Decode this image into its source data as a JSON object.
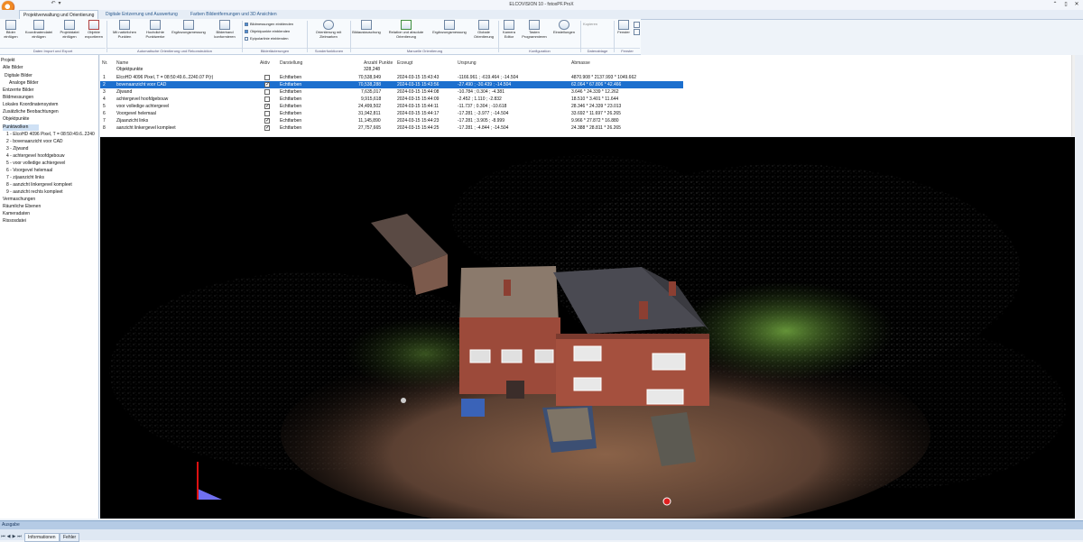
{
  "window": {
    "title": "ELCOVISION 10 - fotoxPF.ProX",
    "controls": [
      "⌃",
      "▯",
      "✕"
    ]
  },
  "quick_access": [
    "↶",
    "▾"
  ],
  "tabs": [
    {
      "label": "Projektverwaltung und Orientierung",
      "active": true
    },
    {
      "label": "Digitale Entzerrung und Auswertung",
      "active": false
    },
    {
      "label": "Farben Bildentfernungen und 3D Ansichten",
      "active": false
    }
  ],
  "ribbon": {
    "buttons": [
      {
        "label": "Bilder einfügen"
      },
      {
        "label": "Koordinatendatei einfügen"
      },
      {
        "label": "Projektdatei einfügen"
      },
      {
        "label": "Objekte exportieren"
      },
      {
        "label": "Mit natürlichen Punkten"
      },
      {
        "label": "Hochdichte Punktwerke"
      },
      {
        "label": "Ergänzungsmessung"
      },
      {
        "label": "Bilderband konformieren"
      },
      {
        "label": "Orientierung mit Zielmarken"
      },
      {
        "label": "Bildaustauschung"
      },
      {
        "label": "Relative und absolute Orientierung"
      },
      {
        "label": "Ergänzungsmessung"
      },
      {
        "label": "Globale Orientierung"
      },
      {
        "label": "Kamera Editor"
      },
      {
        "label": "Tasten Programmieren"
      },
      {
        "label": "Einstellungen"
      },
      {
        "label": "Fenster"
      }
    ],
    "checkboxes": [
      {
        "label": "Bildmessungen einblenden",
        "checked": true
      },
      {
        "label": "Objektpunkte einblenden",
        "checked": true
      },
      {
        "label": "Epipolarlinie einblenden",
        "checked": false
      }
    ],
    "groups": [
      "Daten Import und Export",
      "Automatische Orientierung und Rekonstruktion",
      "Bilderläuterungen",
      "Sonderfunktionen",
      "Manuelle Orientierung",
      "Konfiguration",
      "Datenablage",
      "Fenster"
    ],
    "misc_label": "Kopieren"
  },
  "tree": [
    {
      "label": "Projekt",
      "indent": 0
    },
    {
      "label": "Alle Bilder",
      "indent": 1
    },
    {
      "label": "Digitale Bilder",
      "indent": 2
    },
    {
      "label": "Analoge Bilder",
      "indent": 3
    },
    {
      "label": "Entzerrte Bilder",
      "indent": 1
    },
    {
      "label": "Bildmessungen",
      "indent": 1
    },
    {
      "label": "Lokales Koordinatensystem",
      "indent": 1
    },
    {
      "label": "Zusätzliche Beobachtungen",
      "indent": 1
    },
    {
      "label": "Objektpunkte",
      "indent": 1
    },
    {
      "label": "Punktwolken",
      "indent": 1,
      "selected": true
    },
    {
      "label": "1 - ElcoHD 4096 Pixel, T = 08:50:49.6..2240",
      "indent": 2
    },
    {
      "label": "2 - bovenaanzicht voor CAD",
      "indent": 2
    },
    {
      "label": "3 - Zijwand",
      "indent": 2
    },
    {
      "label": "4 - achtergevel hoofdgebouw",
      "indent": 2
    },
    {
      "label": "5 - voor volledige achtergevel",
      "indent": 2
    },
    {
      "label": "6 - Voorgevel helemaal",
      "indent": 2
    },
    {
      "label": "7 - zijaanzicht links",
      "indent": 2
    },
    {
      "label": "8 - aanzicht linkergevel kompleet",
      "indent": 2
    },
    {
      "label": "9 - aanzicht rechts kompleet",
      "indent": 2
    },
    {
      "label": "Vermaschungen",
      "indent": 1
    },
    {
      "label": "Räumliche Ebenen",
      "indent": 1
    },
    {
      "label": "Kameradaten",
      "indent": 1
    },
    {
      "label": "Rissosdatei",
      "indent": 1
    }
  ],
  "table": {
    "headers": [
      "Nr.",
      "Name",
      "Aktiv",
      "Darstellung",
      "Anzahl Punkte",
      "Erzeugt",
      "Ursprung",
      "Abmasse"
    ],
    "rows": [
      {
        "nr": "",
        "name": "Objektpunkte",
        "active": false,
        "display": "",
        "count": "328,248",
        "created": "",
        "origin": "",
        "dims": ""
      },
      {
        "nr": "1",
        "name": "ElcoHD 4096 Pixel, T = 08:50:49.6..2240.07 P(r)",
        "active": false,
        "display": "Echtfarben",
        "count": "70,538,949",
        "created": "2024-03-15  15:43:43",
        "origin": "-1166.961 ; -619.464 ; -14.504",
        "dims": "4870.908 * 2137.993 * 1049.662"
      },
      {
        "nr": "2",
        "name": "bovenaanzicht voor CAD",
        "active": true,
        "display": "Echtfarben",
        "count": "70,538,288",
        "created": "2024-03-15  15:43:56",
        "origin": "-27.490 ; -30.439 ; -14.504",
        "dims": "62.064 * 67.806 * 42.466",
        "selected": true
      },
      {
        "nr": "3",
        "name": "Zijwand",
        "active": false,
        "display": "Echtfarben",
        "count": "7,635,017",
        "created": "2024-03-15  15:44:08",
        "origin": "-10.784 ; 0.304 ; -4.381",
        "dims": "3.646 * 24.339 * 12.262"
      },
      {
        "nr": "4",
        "name": "achtergevel hoofdgebouw",
        "active": false,
        "display": "Echtfarben",
        "count": "9,915,618",
        "created": "2024-03-15  15:44:09",
        "origin": "-2.452 ; 1.110 ; -2.832",
        "dims": "18.510 * 3.401 * 11.644"
      },
      {
        "nr": "5",
        "name": "voor volledige achtergevel",
        "active": true,
        "display": "Echtfarben",
        "count": "24,499,502",
        "created": "2024-03-15  15:44:11",
        "origin": "-11.737 ; 0.304 ; -10.618",
        "dims": "28.346 * 24.339 * 23.013"
      },
      {
        "nr": "6",
        "name": "Voorgevel helemaal",
        "active": false,
        "display": "Echtfarben",
        "count": "31,942,811",
        "created": "2024-03-15  15:44:17",
        "origin": "-17.281 ; -3.977 ; -14.504",
        "dims": "33.692 * 11.697 * 26.265"
      },
      {
        "nr": "7",
        "name": "Zijaanzicht links",
        "active": true,
        "display": "Echtfarben",
        "count": "11,145,890",
        "created": "2024-03-15  15:44:23",
        "origin": "-17.281 ; 3.905 ; -8.999",
        "dims": "9.966 * 27.872 * 16.880"
      },
      {
        "nr": "8",
        "name": "aanzicht linkergevel kompleet",
        "active": true,
        "display": "Echtfarben",
        "count": "27,757,665",
        "created": "2024-03-15  15:44:25",
        "origin": "-17.281 ; -4.844 ; -14.504",
        "dims": "24.388 * 28.811 * 26.265"
      }
    ]
  },
  "bottom": {
    "output_label": "Ausgabe",
    "status_tabs": [
      "Informationen",
      "Fehler"
    ]
  },
  "colors": {
    "accent": "#1c6fce",
    "ribbon_bg": "#f7fafd",
    "viewport_bg": "#000000"
  }
}
